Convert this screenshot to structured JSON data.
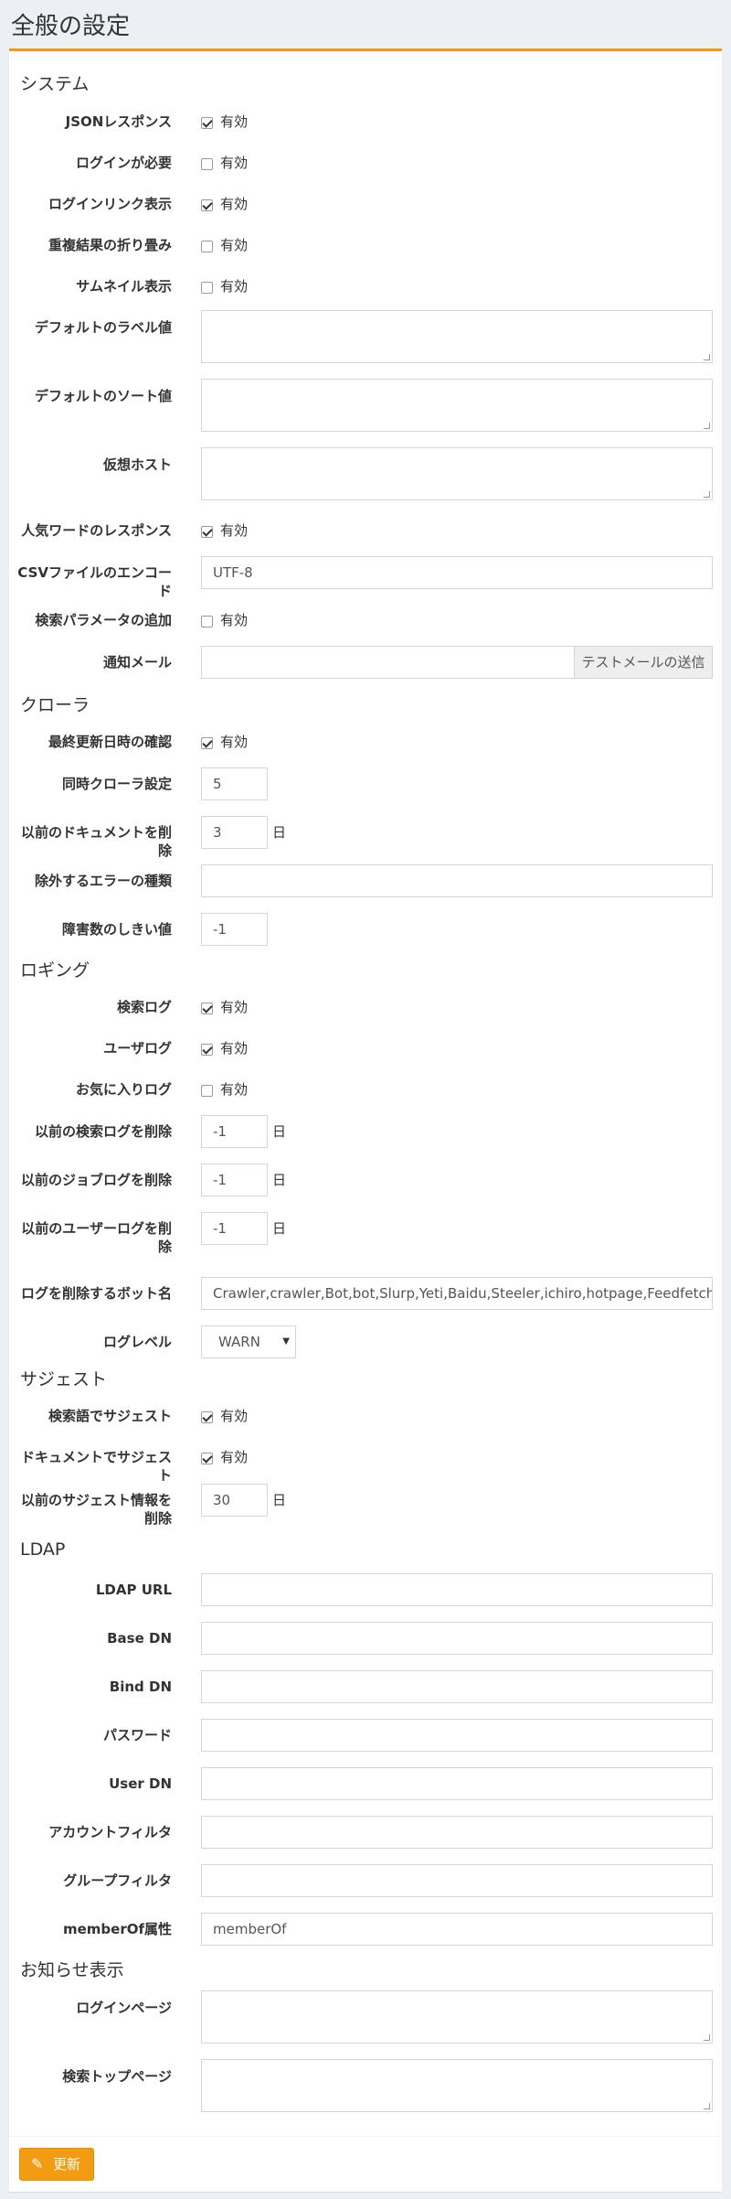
{
  "page": {
    "title": "全般の設定"
  },
  "common": {
    "enabled": "有効",
    "days": "日"
  },
  "system": {
    "heading": "システム",
    "json_response": {
      "label": "JSONレスポンス",
      "checked": true
    },
    "login_required": {
      "label": "ログインが必要",
      "checked": false
    },
    "login_link": {
      "label": "ログインリンク表示",
      "checked": true
    },
    "collapse_duplicates": {
      "label": "重複結果の折り畳み",
      "checked": false
    },
    "thumbnail": {
      "label": "サムネイル表示",
      "checked": false
    },
    "default_label": {
      "label": "デフォルトのラベル値",
      "value": ""
    },
    "default_sort": {
      "label": "デフォルトのソート値",
      "value": ""
    },
    "virtual_host": {
      "label": "仮想ホスト",
      "value": ""
    },
    "popular_word": {
      "label": "人気ワードのレスポンス",
      "checked": true
    },
    "csv_encoding": {
      "label": "CSVファイルのエンコード",
      "value": "UTF-8"
    },
    "append_query_param": {
      "label": "検索パラメータの追加",
      "checked": false
    },
    "notification_mail": {
      "label": "通知メール",
      "value": "",
      "button": "テストメールの送信"
    }
  },
  "crawler": {
    "heading": "クローラ",
    "check_last_modified": {
      "label": "最終更新日時の確認",
      "checked": true
    },
    "concurrent": {
      "label": "同時クローラ設定",
      "value": "5"
    },
    "purge_docs": {
      "label": "以前のドキュメントを削除",
      "value": "3"
    },
    "excluded_errors": {
      "label": "除外するエラーの種類",
      "value": ""
    },
    "failure_threshold": {
      "label": "障害数のしきい値",
      "value": "-1"
    }
  },
  "logging": {
    "heading": "ロギング",
    "search_log": {
      "label": "検索ログ",
      "checked": true
    },
    "user_log": {
      "label": "ユーザログ",
      "checked": true
    },
    "favorite_log": {
      "label": "お気に入りログ",
      "checked": false
    },
    "purge_search_log": {
      "label": "以前の検索ログを削除",
      "value": "-1"
    },
    "purge_job_log": {
      "label": "以前のジョブログを削除",
      "value": "-1"
    },
    "purge_user_log": {
      "label_line1": "以前のユーザーログを削",
      "label_line2": "除",
      "value": "-1"
    },
    "bot_names": {
      "label": "ログを削除するボット名",
      "value": "Crawler,crawler,Bot,bot,Slurp,Yeti,Baidu,Steeler,ichiro,hotpage,Feedfetcher,ia_archiver"
    },
    "log_level": {
      "label": "ログレベル",
      "value": "WARN"
    }
  },
  "suggest": {
    "heading": "サジェスト",
    "by_search_word": {
      "label": "検索語でサジェスト",
      "checked": true
    },
    "by_document": {
      "label": "ドキュメントでサジェスト",
      "checked": true
    },
    "purge_suggest": {
      "label_line1": "以前のサジェスト情報を",
      "label_line2": "削除",
      "value": "30"
    }
  },
  "ldap": {
    "heading": "LDAP",
    "url": {
      "label": "LDAP URL",
      "value": ""
    },
    "base_dn": {
      "label": "Base DN",
      "value": ""
    },
    "bind_dn": {
      "label": "Bind DN",
      "value": ""
    },
    "password": {
      "label": "パスワード",
      "value": ""
    },
    "user_dn": {
      "label": "User DN",
      "value": ""
    },
    "account_filter": {
      "label": "アカウントフィルタ",
      "value": ""
    },
    "group_filter": {
      "label": "グループフィルタ",
      "value": ""
    },
    "member_of": {
      "label": "memberOf属性",
      "value": "memberOf"
    }
  },
  "notice": {
    "heading": "お知らせ表示",
    "login_page": {
      "label": "ログインページ",
      "value": ""
    },
    "search_top": {
      "label": "検索トップページ",
      "value": ""
    }
  },
  "footer": {
    "update_label": "更新",
    "update_icon": "pencil-icon"
  }
}
